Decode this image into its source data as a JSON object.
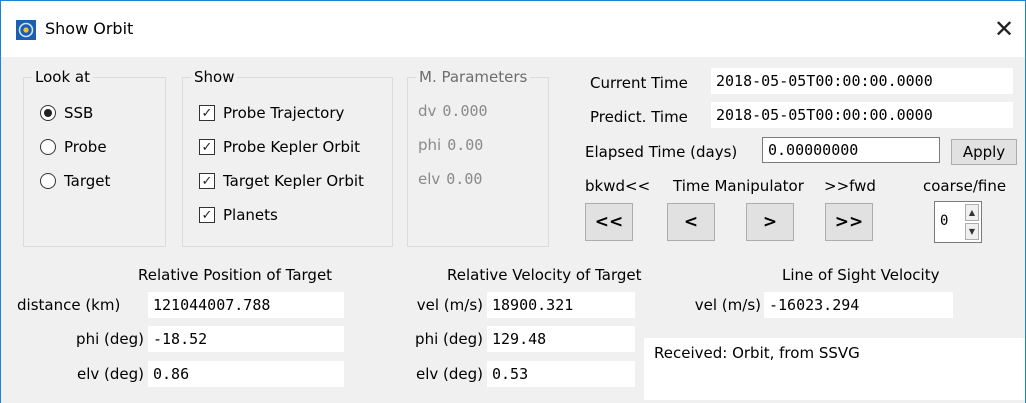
{
  "window": {
    "title": "Show Orbit",
    "close_glyph": "✕"
  },
  "look_at": {
    "title": "Look at",
    "options": [
      {
        "label": "SSB",
        "selected": true
      },
      {
        "label": "Probe",
        "selected": false
      },
      {
        "label": "Target",
        "selected": false
      }
    ]
  },
  "show": {
    "title": "Show",
    "items": [
      {
        "label": "Probe Trajectory",
        "checked": true
      },
      {
        "label": "Probe Kepler Orbit",
        "checked": true
      },
      {
        "label": "Target Kepler Orbit",
        "checked": true
      },
      {
        "label": "Planets",
        "checked": true
      }
    ]
  },
  "m_parameters": {
    "title": "M. Parameters",
    "rows": [
      {
        "label": "dv",
        "value": "0.000"
      },
      {
        "label": "phi",
        "value": "0.00"
      },
      {
        "label": "elv",
        "value": "0.00"
      }
    ]
  },
  "time": {
    "current_label": "Current Time",
    "current_value": "2018-05-05T00:00:00.0000",
    "predict_label": "Predict. Time",
    "predict_value": "2018-05-05T00:00:00.0000",
    "elapsed_label": "Elapsed Time (days)",
    "elapsed_value": "0.00000000",
    "apply_label": "Apply"
  },
  "manipulator": {
    "bkwd_label": "bkwd<<",
    "title": "Time Manipulator",
    "fwd_label": ">>fwd",
    "coarse_fine_label": "coarse/fine",
    "buttons": [
      "<<",
      "<",
      ">",
      ">>"
    ],
    "step_value": "0"
  },
  "relative_position": {
    "title": "Relative Position of Target",
    "distance_label": "distance (km)",
    "distance_value": "121044007.788",
    "phi_label": "phi (deg)",
    "phi_value": "-18.52",
    "elv_label": "elv (deg)",
    "elv_value": "0.86"
  },
  "relative_velocity": {
    "title": "Relative Velocity of Target",
    "vel_label": "vel (m/s)",
    "vel_value": "18900.321",
    "phi_label": "phi (deg)",
    "phi_value": "129.48",
    "elv_label": "elv (deg)",
    "elv_value": "0.53"
  },
  "line_of_sight": {
    "title": "Line of Sight Velocity",
    "vel_label": "vel (m/s)",
    "vel_value": "-16023.294"
  },
  "status": {
    "message": "Received: Orbit, from SSVG"
  }
}
